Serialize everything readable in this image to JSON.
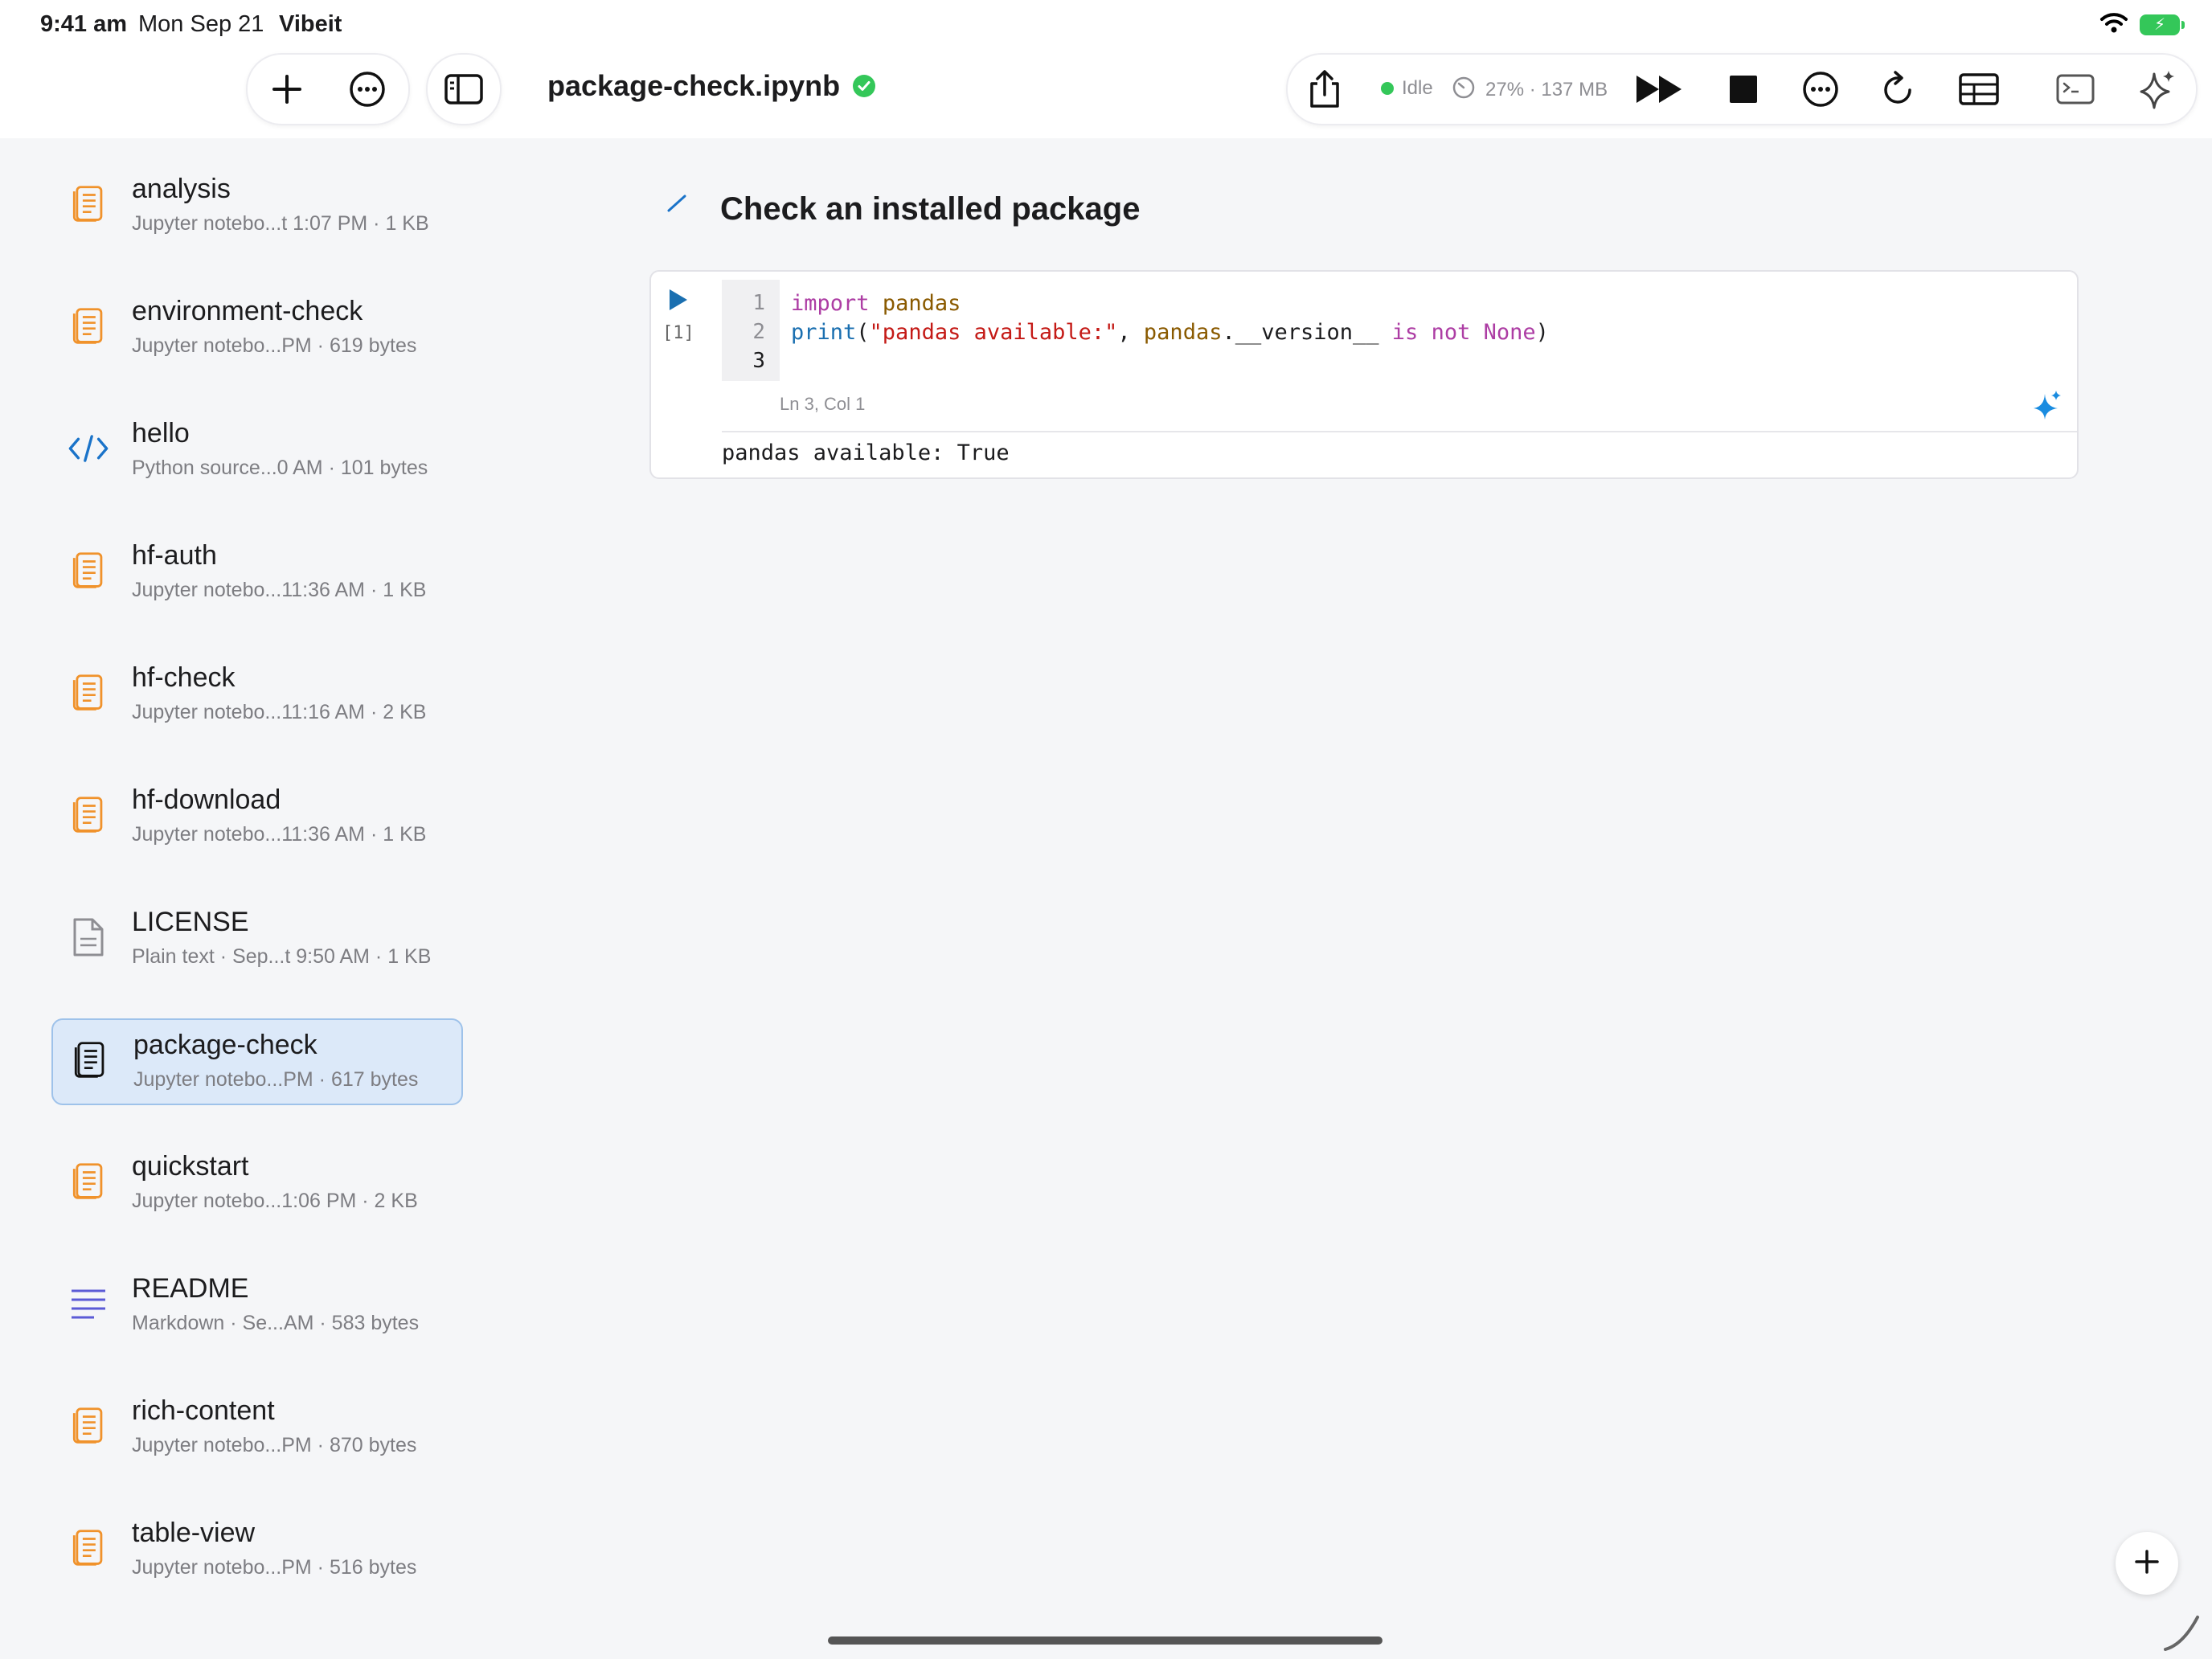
{
  "status_bar": {
    "time": "9:41 am",
    "date": "Mon Sep 21",
    "app": "Vibeit",
    "battery_color": "#34c759"
  },
  "toolbar": {
    "left_icons": [
      "plus-icon",
      "more-icon"
    ],
    "sidebar_icon": "sidebar-toggle-icon",
    "document_title": "package-check.ipynb",
    "saved_icon": "checkmark-circle-icon",
    "kernel_state": "Idle",
    "memory_usage": "27% · 137 MB",
    "right_icons": [
      "share-icon",
      "run-all-icon",
      "stop-icon",
      "more-icon",
      "restart-icon",
      "table-icon",
      "terminal-icon",
      "sparkle-icon"
    ]
  },
  "sidebar": {
    "items": [
      {
        "name": "analysis",
        "meta": "Jupyter notebo...t 1:07 PM · 1 KB",
        "icon": "notebook-icon",
        "selected": false
      },
      {
        "name": "environment-check",
        "meta": "Jupyter notebo...PM · 619 bytes",
        "icon": "notebook-icon",
        "selected": false
      },
      {
        "name": "hello",
        "meta": "Python source...0 AM · 101 bytes",
        "icon": "code-icon",
        "selected": false
      },
      {
        "name": "hf-auth",
        "meta": "Jupyter notebo...11:36 AM · 1 KB",
        "icon": "notebook-icon",
        "selected": false
      },
      {
        "name": "hf-check",
        "meta": "Jupyter notebo...11:16 AM · 2 KB",
        "icon": "notebook-icon",
        "selected": false
      },
      {
        "name": "hf-download",
        "meta": "Jupyter notebo...11:36 AM · 1 KB",
        "icon": "notebook-icon",
        "selected": false
      },
      {
        "name": "LICENSE",
        "meta": "Plain text · Sep...t 9:50 AM · 1 KB",
        "icon": "text-file-icon",
        "selected": false
      },
      {
        "name": "package-check",
        "meta": "Jupyter notebo...PM · 617 bytes",
        "icon": "notebook-icon",
        "selected": true
      },
      {
        "name": "quickstart",
        "meta": "Jupyter notebo...1:06 PM · 2 KB",
        "icon": "notebook-icon",
        "selected": false
      },
      {
        "name": "README",
        "meta": "Markdown · Se...AM · 583 bytes",
        "icon": "markdown-icon",
        "selected": false
      },
      {
        "name": "rich-content",
        "meta": "Jupyter notebo...PM · 870 bytes",
        "icon": "notebook-icon",
        "selected": false
      },
      {
        "name": "table-view",
        "meta": "Jupyter notebo...PM · 516 bytes",
        "icon": "notebook-icon",
        "selected": false
      }
    ]
  },
  "notebook": {
    "markdown_heading": "Check an installed package",
    "code_cell": {
      "execution_count": "[1]",
      "line_numbers": [
        "1",
        "2",
        "3"
      ],
      "line1": {
        "kw": "import",
        "sp": " ",
        "mod": "pandas"
      },
      "line2": {
        "fn": "print",
        "open": "(",
        "str": "\"pandas available:\"",
        "comma": ", ",
        "mod": "pandas",
        "attr": ".__version__ ",
        "kw1": "is",
        "sp1": " ",
        "kw2": "not",
        "sp2": " ",
        "kw3": "None",
        "close": ")"
      },
      "cursor_position": "Ln 3, Col 1",
      "output": "pandas available: True"
    }
  },
  "colors": {
    "accent": "#1a73c9",
    "notebook_icon": "#f0922b",
    "selected_bg": "#dce9f9"
  }
}
